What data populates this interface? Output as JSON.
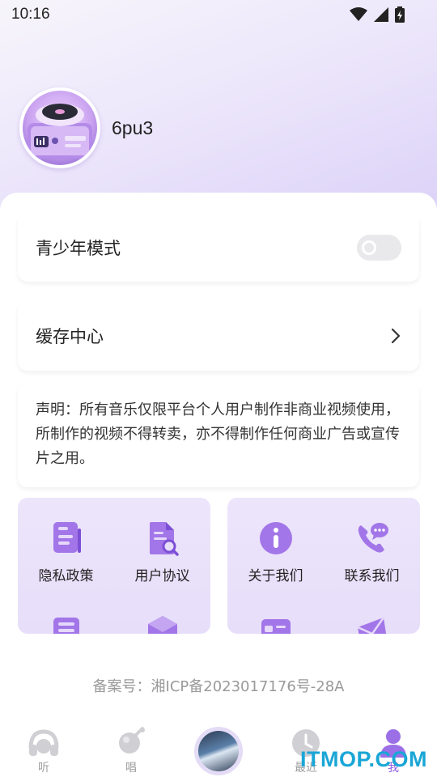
{
  "status_bar": {
    "time": "10:16"
  },
  "profile": {
    "username": "6pu3"
  },
  "settings": {
    "teen_mode_label": "青少年模式",
    "teen_mode_on": false,
    "cache_label": "缓存中心"
  },
  "notice": "声明：所有音乐仅限平台个人用户制作非商业视频使用，所制作的视频不得转卖，亦不得制作任何商业广告或宣传片之用。",
  "grid_left": {
    "items": [
      {
        "label": "隐私政策",
        "icon": "document-icon"
      },
      {
        "label": "用户协议",
        "icon": "file-search-icon"
      }
    ]
  },
  "grid_right": {
    "items": [
      {
        "label": "关于我们",
        "icon": "info-icon"
      },
      {
        "label": "联系我们",
        "icon": "phone-chat-icon"
      }
    ]
  },
  "footer": {
    "record": "备案号：湘ICP备2023017176号-28A"
  },
  "tabbar": {
    "tabs": [
      {
        "label": "听",
        "icon": "headphones-icon"
      },
      {
        "label": "唱",
        "icon": "microphone-icon"
      },
      {
        "label": "",
        "icon": "disc-icon"
      },
      {
        "label": "最近",
        "icon": "clock-icon"
      },
      {
        "label": "我",
        "icon": "user-icon"
      }
    ],
    "active_index": 4
  },
  "watermark": "ITMOP.COM",
  "colors": {
    "accent": "#8e5fe0",
    "icon_purple": "#9b6fe6",
    "tab_inactive": "#d0d0d4"
  }
}
